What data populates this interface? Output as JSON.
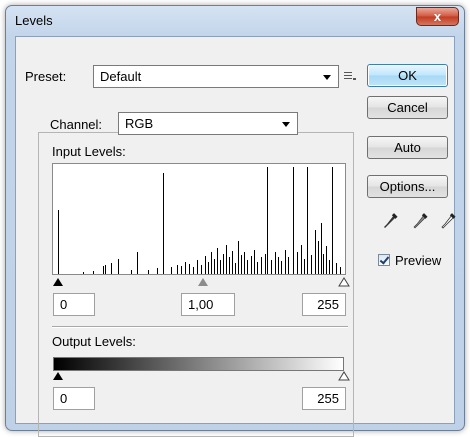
{
  "window": {
    "title": "Levels",
    "close_glyph": "x"
  },
  "preset": {
    "label": "Preset:",
    "value": "Default",
    "menu_icon": "preset-options-icon"
  },
  "channel": {
    "label": "Channel:",
    "value": "RGB"
  },
  "input_levels": {
    "label": "Input Levels:",
    "black": "0",
    "gamma": "1,00",
    "white": "255",
    "histogram": [
      [
        5,
        0.58
      ],
      [
        30,
        0.02
      ],
      [
        40,
        0.03
      ],
      [
        50,
        0.07
      ],
      [
        52,
        0.08
      ],
      [
        58,
        0.1
      ],
      [
        65,
        0.14
      ],
      [
        78,
        0.04
      ],
      [
        84,
        0.2
      ],
      [
        95,
        0.04
      ],
      [
        104,
        0.05
      ],
      [
        110,
        0.92
      ],
      [
        118,
        0.06
      ],
      [
        124,
        0.08
      ],
      [
        128,
        0.07
      ],
      [
        132,
        0.11
      ],
      [
        136,
        0.09
      ],
      [
        140,
        0.06
      ],
      [
        144,
        0.13
      ],
      [
        148,
        0.08
      ],
      [
        152,
        0.16
      ],
      [
        155,
        0.11
      ],
      [
        158,
        0.2
      ],
      [
        161,
        0.14
      ],
      [
        164,
        0.24
      ],
      [
        167,
        0.13
      ],
      [
        170,
        0.18
      ],
      [
        173,
        0.26
      ],
      [
        176,
        0.15
      ],
      [
        179,
        0.21
      ],
      [
        182,
        0.1
      ],
      [
        185,
        0.3
      ],
      [
        188,
        0.17
      ],
      [
        191,
        0.2
      ],
      [
        194,
        0.13
      ],
      [
        198,
        0.16
      ],
      [
        201,
        0.22
      ],
      [
        204,
        0.11
      ],
      [
        208,
        0.15
      ],
      [
        212,
        0.18
      ],
      [
        214,
        0.97
      ],
      [
        218,
        0.13
      ],
      [
        222,
        0.2
      ],
      [
        225,
        0.15
      ],
      [
        228,
        0.12
      ],
      [
        232,
        0.22
      ],
      [
        235,
        0.15
      ],
      [
        240,
        0.97
      ],
      [
        244,
        0.2
      ],
      [
        248,
        0.26
      ],
      [
        251,
        0.14
      ],
      [
        254,
        0.97
      ],
      [
        258,
        0.17
      ],
      [
        262,
        0.4
      ],
      [
        265,
        0.3
      ],
      [
        268,
        0.46
      ],
      [
        270,
        0.18
      ],
      [
        273,
        0.25
      ],
      [
        276,
        0.13
      ],
      [
        279,
        0.97
      ],
      [
        283,
        0.1
      ],
      [
        287,
        0.06
      ]
    ]
  },
  "output_levels": {
    "label": "Output Levels:",
    "black": "0",
    "white": "255"
  },
  "buttons": {
    "ok": "OK",
    "cancel": "Cancel",
    "auto": "Auto",
    "options": "Options..."
  },
  "preview": {
    "label": "Preview",
    "checked": true
  }
}
